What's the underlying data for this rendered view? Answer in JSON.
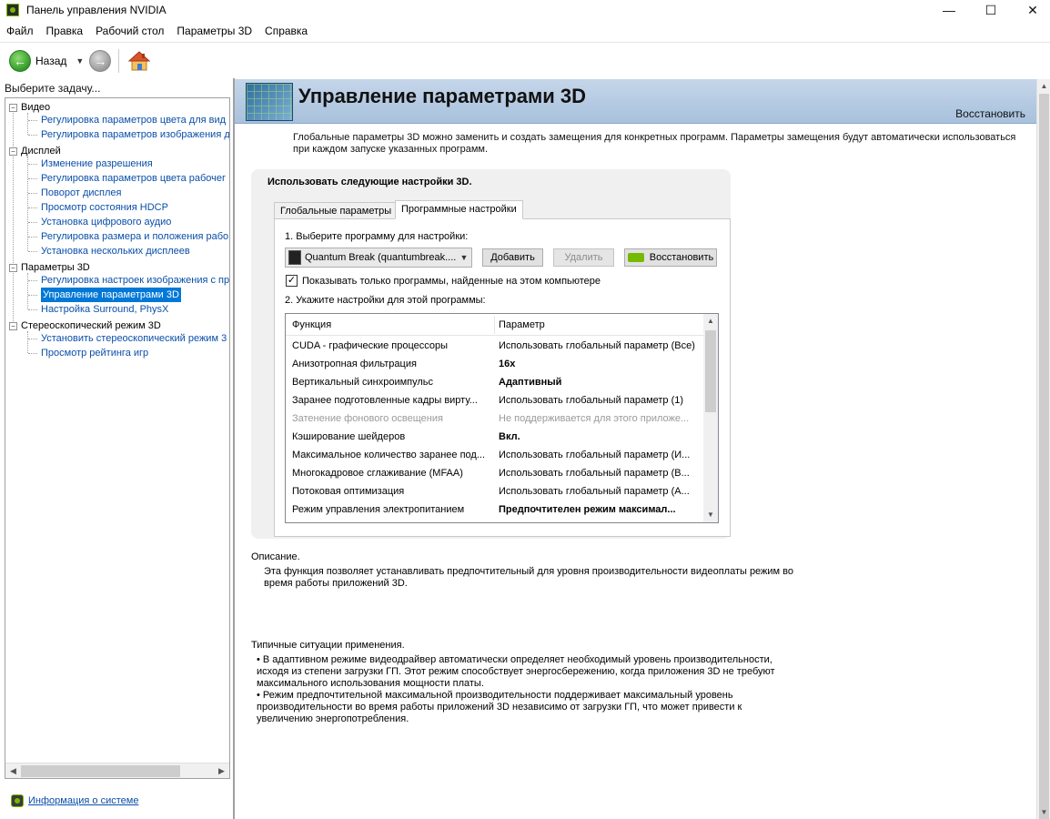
{
  "window": {
    "title": "Панель управления NVIDIA",
    "minimize": "—",
    "maximize": "☐",
    "close": "✕"
  },
  "menu": [
    "Файл",
    "Правка",
    "Рабочий стол",
    "Параметры 3D",
    "Справка"
  ],
  "toolbar": {
    "back_label": "Назад"
  },
  "left": {
    "header": "Выберите задачу...",
    "tree": [
      {
        "label": "Видео",
        "items": [
          "Регулировка параметров цвета для вид",
          "Регулировка параметров изображения д"
        ]
      },
      {
        "label": "Дисплей",
        "items": [
          "Изменение разрешения",
          "Регулировка параметров цвета рабочег",
          "Поворот дисплея",
          "Просмотр состояния HDCP",
          "Установка цифрового аудио",
          "Регулировка размера и положения рабо",
          "Установка нескольких дисплеев"
        ]
      },
      {
        "label": "Параметры 3D",
        "items": [
          "Регулировка настроек изображения с пр",
          "Управление параметрами 3D",
          "Настройка Surround, PhysX"
        ]
      },
      {
        "label": "Стереоскопический режим 3D",
        "items": [
          "Установить стереоскопический режим 3",
          "Просмотр рейтинга игр"
        ]
      }
    ],
    "selected": "Управление параметрами 3D",
    "sysinfo_link": "Информация о системе"
  },
  "main": {
    "title": "Управление параметрами 3D",
    "restore": "Восстановить",
    "intro": "Глобальные параметры 3D можно заменить и создать замещения для конкретных программ. Параметры замещения будут автоматически использоваться при каждом запуске указанных программ.",
    "group_title": "Использовать следующие настройки 3D.",
    "tabs": [
      "Глобальные параметры",
      "Программные настройки"
    ],
    "active_tab": "Программные настройки",
    "step1": "1. Выберите программу для настройки:",
    "program_selected": "Quantum Break (quantumbreak....",
    "add_button": "Добавить",
    "remove_button": "Удалить",
    "restore_button": "Восстановить",
    "show_only_checkbox": "Показывать только программы, найденные на этом компьютере",
    "show_only_checked": true,
    "step2": "2. Укажите настройки для этой программы:",
    "grid_headers": [
      "Функция",
      "Параметр"
    ],
    "grid_rows": [
      {
        "feature": "CUDA - графические процессоры",
        "value": "Использовать глобальный параметр (Все)",
        "bold": false,
        "disabled": false
      },
      {
        "feature": "Анизотропная фильтрация",
        "value": "16x",
        "bold": true,
        "disabled": false
      },
      {
        "feature": "Вертикальный синхроимпульс",
        "value": "Адаптивный",
        "bold": true,
        "disabled": false
      },
      {
        "feature": "Заранее подготовленные кадры вирту...",
        "value": "Использовать глобальный параметр (1)",
        "bold": false,
        "disabled": false
      },
      {
        "feature": "Затенение фонового освещения",
        "value": "Не поддерживается для этого приложе...",
        "bold": false,
        "disabled": true
      },
      {
        "feature": "Кэширование шейдеров",
        "value": "Вкл.",
        "bold": true,
        "disabled": false
      },
      {
        "feature": "Максимальное количество заранее под...",
        "value": "Использовать глобальный параметр (И...",
        "bold": false,
        "disabled": false
      },
      {
        "feature": "Многокадровое сглаживание (MFAA)",
        "value": "Использовать глобальный параметр (В...",
        "bold": false,
        "disabled": false
      },
      {
        "feature": "Потоковая оптимизация",
        "value": "Использовать глобальный параметр (А...",
        "bold": false,
        "disabled": false
      },
      {
        "feature": "Режим управления электропитанием",
        "value": "Предпочтителен режим максимал...",
        "bold": true,
        "disabled": false
      }
    ],
    "description_label": "Описание.",
    "description_text": "Эта функция позволяет устанавливать предпочтительный для уровня производительности видеоплаты режим во время работы приложений 3D.",
    "typical_label": "Типичные ситуации применения.",
    "typical_items": [
      "• В адаптивном режиме видеодрайвер автоматически определяет необходимый уровень производительности, исходя из степени загрузки ГП. Этот режим способствует энергосбережению, когда приложения 3D не требуют максимального использования мощности платы.",
      "• Режим предпочтительной максимальной производительности поддерживает максимальный уровень производительности во время работы приложений 3D независимо от загрузки ГП, что может привести к увеличению энергопотребления."
    ]
  }
}
